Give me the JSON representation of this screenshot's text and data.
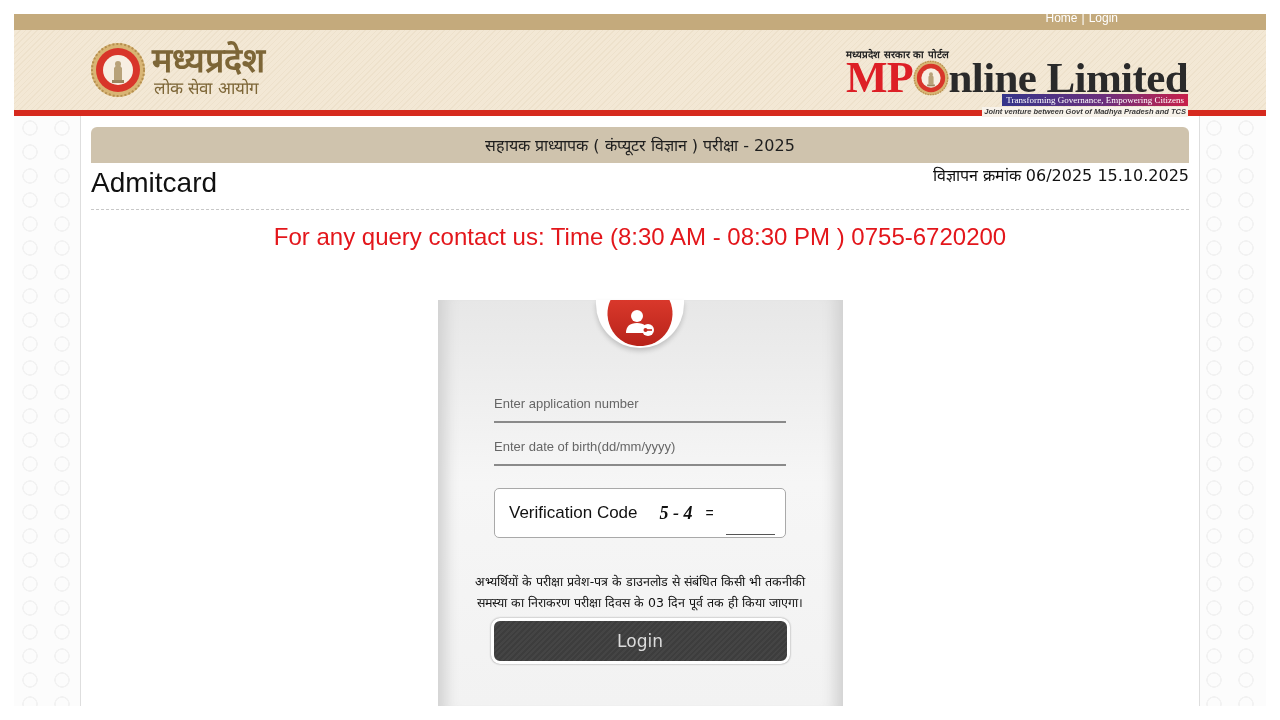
{
  "top_bar": {
    "links": [
      "Home",
      "Login"
    ],
    "separator": "|"
  },
  "header": {
    "commission_logo": {
      "title": "मध्यप्रदेश",
      "subtitle": "लोक सेवा आयोग"
    },
    "portal_logo": {
      "caption": "मध्यप्रदेश सरकार का पोर्टल",
      "name_start": "MP",
      "name_end": "nline Limited",
      "tagline": "Transforming Governance, Empowering Citizens",
      "joint_venture": "Joint venture between Govt of Madhya Pradesh and TCS"
    }
  },
  "exam_title": "सहायक प्राध्यापक ( कंप्यूटर विज्ञान ) परीक्षा - 2025",
  "page_title": "Admitcard",
  "advertisement": "विज्ञापन क्रमांक 06/2025 15.10.2025",
  "helpline": "For any query contact us: Time (8:30 AM - 08:30 PM ) 0755-6720200",
  "login_form": {
    "fields": [
      {
        "placeholder": "Enter application number"
      },
      {
        "placeholder": "Enter date of birth(dd/mm/yyyy)"
      }
    ],
    "captcha": {
      "label": "Verification Code",
      "question": "5 - 4",
      "operator": "="
    },
    "notice": "अभ्यर्थियों के परीक्षा प्रवेश-पत्र के डाउनलोड से संबंधित किसी भी तकनीकी समस्या का निराकरण परीक्षा दिवस के 03 दिन पूर्व तक ही किया जाएगा।",
    "button": "Login"
  }
}
